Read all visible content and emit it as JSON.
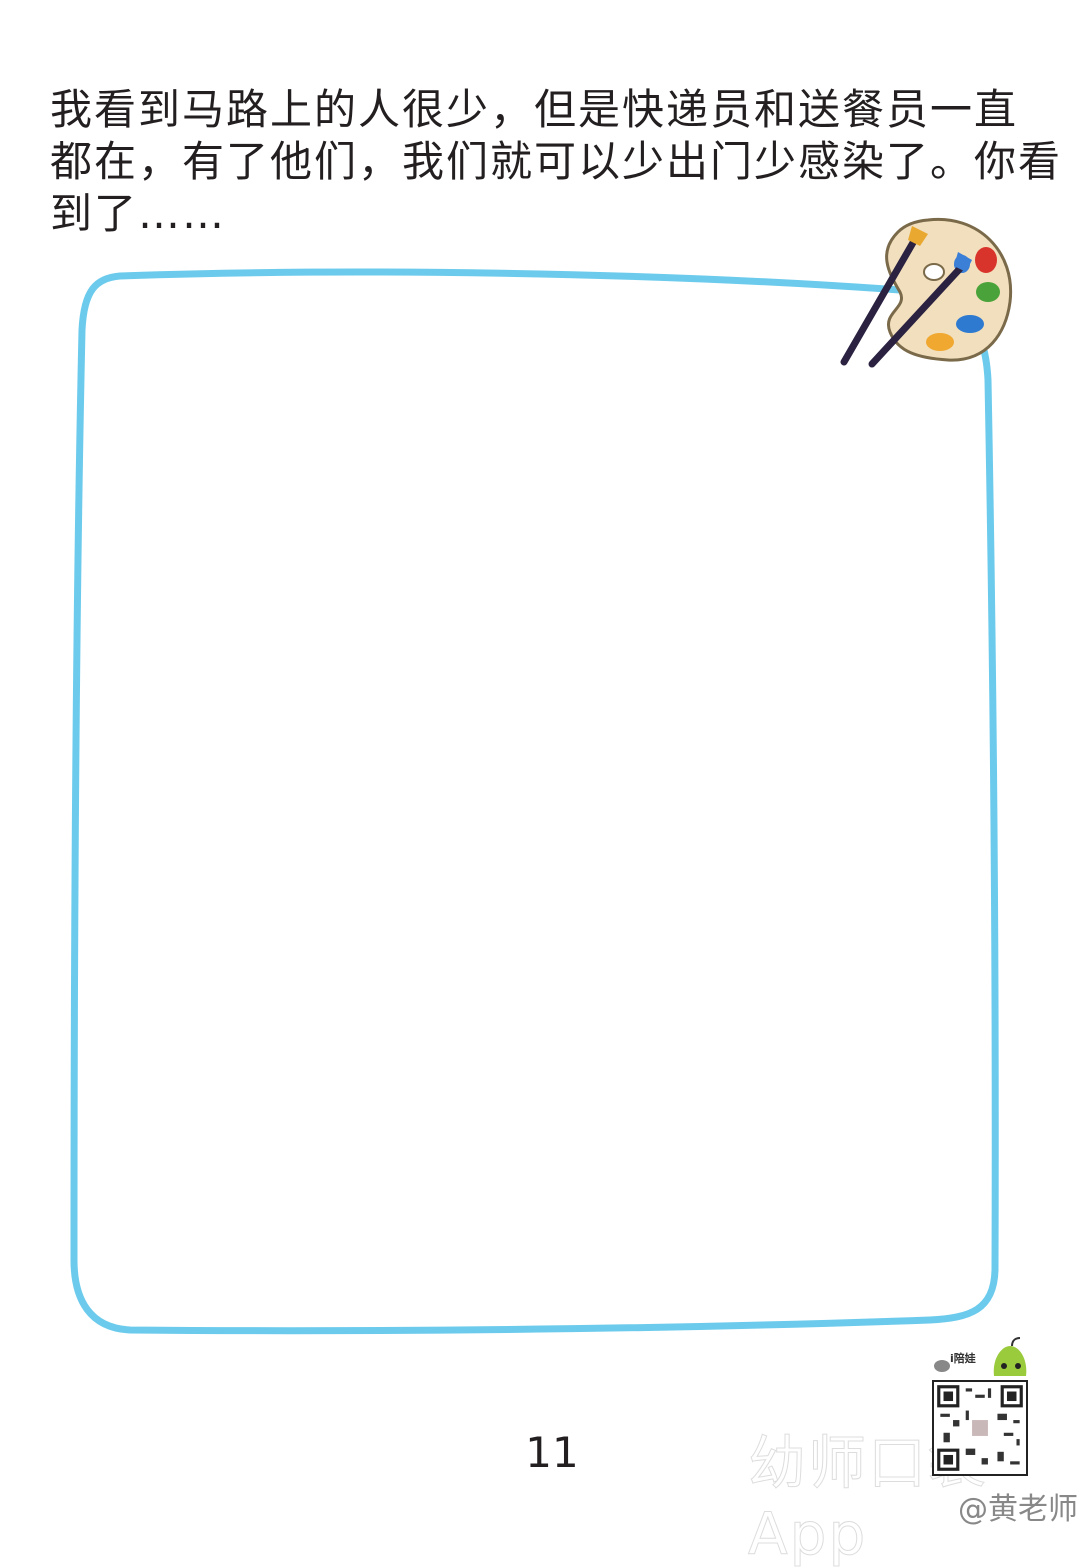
{
  "prompt": {
    "lines": [
      "我看到马路上的人很少，但是快递员和送餐员一直",
      "都在，有了他们，我们就可以少出门少感染了。你看",
      "到了……"
    ]
  },
  "frame": {
    "color": "#6ccbec"
  },
  "page_number": "11",
  "qr": {
    "brand": "i陪娃"
  },
  "watermark": {
    "text": "幼师口袋App",
    "credit": "@黄老师"
  }
}
